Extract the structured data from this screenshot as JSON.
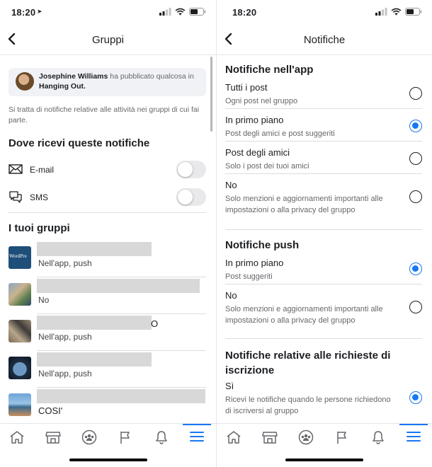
{
  "status": {
    "time": "18:20"
  },
  "left": {
    "title": "Gruppi",
    "preview": {
      "author": "Josephine Williams",
      "action": " ha pubblicato qualcosa in ",
      "group": "Hanging Out."
    },
    "info_text": "Si tratta di notifiche relative alle attività nei gruppi di cui fai parte.",
    "delivery_heading": "Dove ricevi queste notifiche",
    "delivery": [
      {
        "label": "E-mail",
        "icon": "mail-icon",
        "enabled": false
      },
      {
        "label": "SMS",
        "icon": "chat-bubble-icon",
        "enabled": false
      }
    ],
    "groups_heading": "I tuoi gruppi",
    "groups": [
      {
        "name_suffix": "",
        "setting": "Nell'app, push",
        "thumb_text": "WordPre"
      },
      {
        "name_suffix": "",
        "setting": "No"
      },
      {
        "name_suffix": "O",
        "setting": "Nell'app, push"
      },
      {
        "name_suffix": "",
        "setting": "Nell'app, push"
      },
      {
        "name_suffix": "",
        "setting": "COSI'"
      }
    ]
  },
  "right": {
    "title": "Notifiche",
    "sections": [
      {
        "heading": "Notifiche nell'app",
        "options": [
          {
            "title": "Tutti i post",
            "subtitle": "Ogni post nel gruppo",
            "selected": false
          },
          {
            "title": "In primo piano",
            "subtitle": "Post degli amici e post suggeriti",
            "selected": true
          },
          {
            "title": "Post degli amici",
            "subtitle": "Solo i post dei tuoi amici",
            "selected": false
          },
          {
            "title": "No",
            "subtitle": "Solo menzioni e aggiornamenti importanti alle impostazioni o alla privacy del gruppo",
            "selected": false
          }
        ]
      },
      {
        "heading": "Notifiche push",
        "options": [
          {
            "title": "In primo piano",
            "subtitle": "Post suggeriti",
            "selected": true
          },
          {
            "title": "No",
            "subtitle": "Solo menzioni e aggiornamenti importanti alle impostazioni o alla privacy del gruppo",
            "selected": false
          }
        ]
      },
      {
        "heading": "Notifiche relative alle richieste di iscrizione",
        "options": [
          {
            "title": "Sì",
            "subtitle": "Ricevi le notifiche quando le persone richiedono di iscriversi al gruppo",
            "selected": true
          }
        ]
      }
    ]
  },
  "tabbar": {
    "items": [
      "home-icon",
      "marketplace-icon",
      "groups-icon",
      "pages-flag-icon",
      "notifications-bell-icon",
      "menu-icon"
    ],
    "active": "menu-icon"
  },
  "colors": {
    "accent": "#1877f2",
    "toggle_off": "#e9e9eb",
    "preview_bg": "#f0f2f5"
  }
}
